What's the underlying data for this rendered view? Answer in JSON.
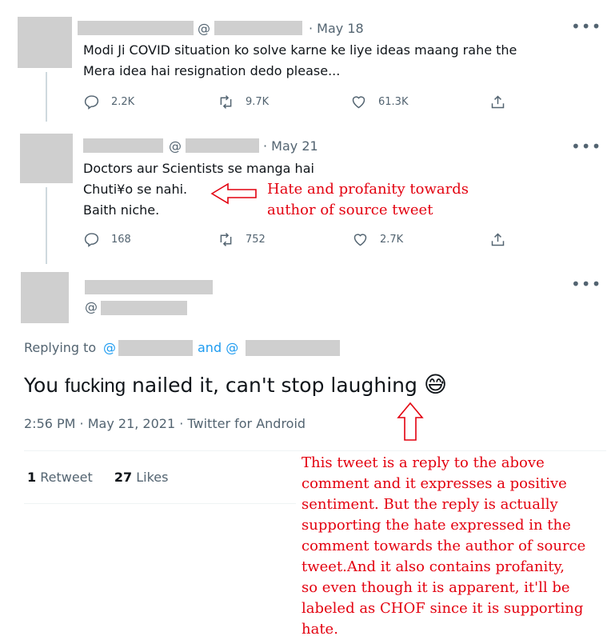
{
  "tweet1": {
    "handle_at": "@",
    "date": "· May 18",
    "lines": [
      "Modi Ji COVID situation ko solve karne ke liye ideas maang rahe the",
      "Mera idea hai resignation dedo please..."
    ],
    "replies": "2.2K",
    "retweets": "9.7K",
    "likes": "61.3K"
  },
  "tweet2": {
    "handle_at": "@",
    "date": "· May 21",
    "lines": [
      "Doctors aur Scientists se manga hai",
      "Chuti¥o se nahi.",
      "Baith niche."
    ],
    "replies": "168",
    "retweets": "752",
    "likes": "2.7K"
  },
  "tweet3": {
    "handle_at": "@",
    "replying_to": "Replying to",
    "replying_at1": "@",
    "replying_and": "and @",
    "text_before": "You ",
    "text_profanity": "fucking",
    "text_after": " nailed it, can't stop laughing",
    "emoji": "😅",
    "timestamp": "2:56 PM · May 21, 2021 · Twitter for Android",
    "retweet_count": "1",
    "retweet_label": "Retweet",
    "likes_count": "27",
    "likes_label": "Likes"
  },
  "more_icon": "more-icon",
  "annotations": {
    "hate_note": [
      "Hate and profanity towards",
      "author of source tweet"
    ],
    "reply_note": [
      "This tweet is a reply to the above",
      "comment and it expresses a positive",
      "sentiment. But the reply is actually",
      "supporting the hate expressed in the",
      "comment towards the author of source",
      "tweet.And it also contains profanity,",
      "so even though it is apparent, it'll be",
      "labeled as CHOF since it is supporting",
      "hate."
    ],
    "color": "#e3000f"
  }
}
